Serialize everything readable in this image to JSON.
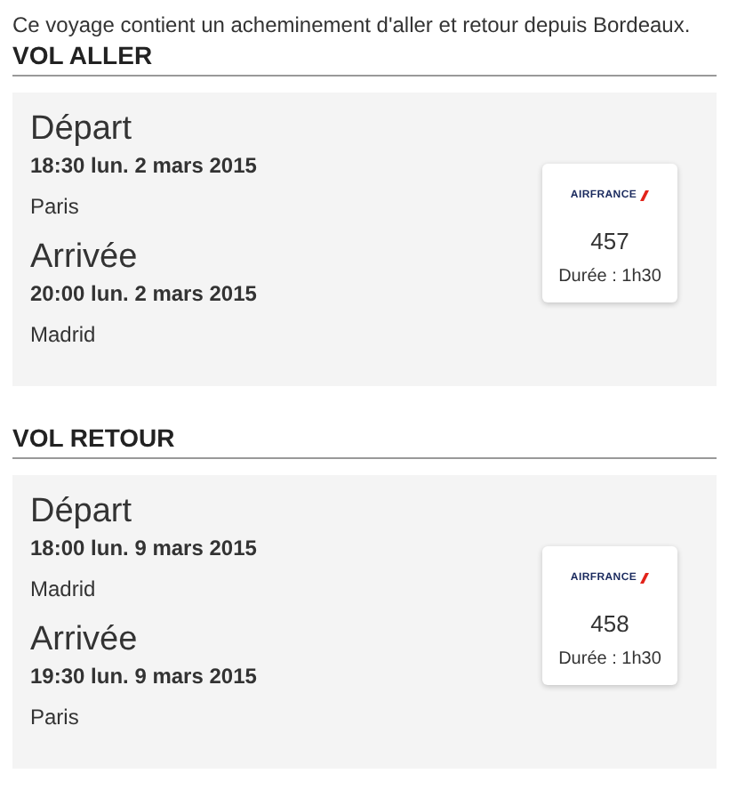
{
  "intro": "Ce voyage contient un acheminement d'aller et retour depuis Bordeaux.",
  "flights": [
    {
      "heading": "VOL ALLER",
      "departure_label": "Départ",
      "departure_time": "18:30 lun. 2 mars 2015",
      "departure_city": "Paris",
      "arrival_label": "Arrivée",
      "arrival_time": "20:00 lun. 2 mars 2015",
      "arrival_city": "Madrid",
      "airline": "AIRFRANCE",
      "number": "457",
      "duration": "Durée : 1h30"
    },
    {
      "heading": "VOL RETOUR",
      "departure_label": "Départ",
      "departure_time": "18:00 lun. 9 mars 2015",
      "departure_city": "Madrid",
      "arrival_label": "Arrivée",
      "arrival_time": "19:30 lun. 9 mars 2015",
      "arrival_city": "Paris",
      "airline": "AIRFRANCE",
      "number": "458",
      "duration": "Durée : 1h30"
    }
  ]
}
